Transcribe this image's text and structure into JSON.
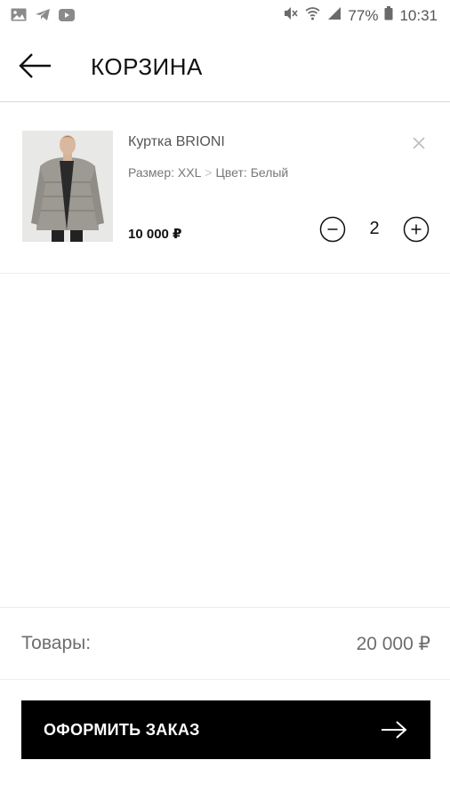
{
  "status_bar": {
    "left_icons": [
      "gallery-icon",
      "telegram-icon",
      "youtube-icon"
    ],
    "right_icons": [
      "mute-icon",
      "wifi-icon",
      "signal-icon",
      "battery-icon"
    ],
    "battery": "77%",
    "time": "10:31"
  },
  "header": {
    "title": "КОРЗИНА",
    "back_icon": "arrow-left-icon"
  },
  "cart": {
    "items": [
      {
        "name": "Куртка BRIONI",
        "size": "Размер: XXL",
        "color": "Цвет: Белый",
        "price": "10 000 ₽",
        "quantity": "2"
      }
    ]
  },
  "totals": {
    "label": "Товары:",
    "value": "20 000 ₽"
  },
  "checkout": {
    "label": "ОФОРМИТЬ ЗАКАЗ"
  }
}
